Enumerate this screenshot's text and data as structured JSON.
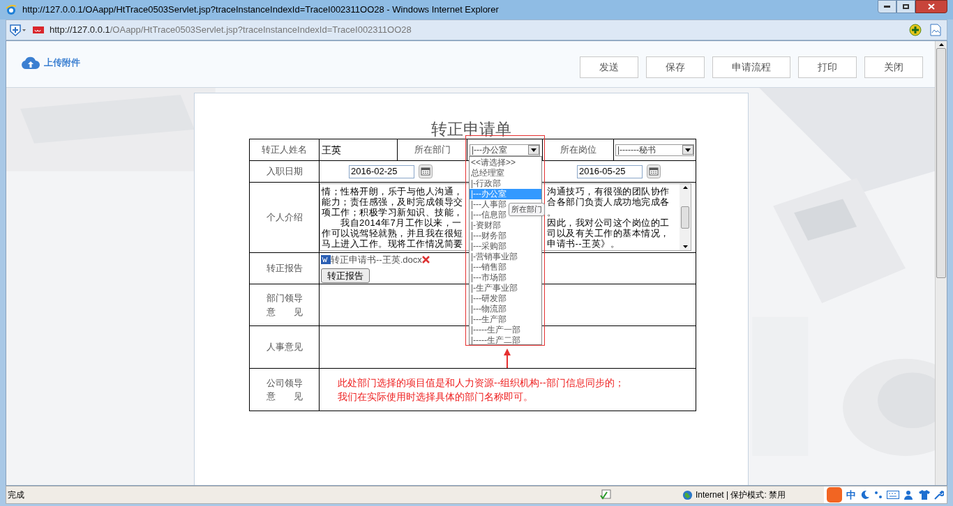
{
  "window": {
    "title": "http://127.0.0.1/OAapp/HtTrace0503Servlet.jsp?traceInstanceIndexId=TraceI002311OO28 - Windows Internet Explorer"
  },
  "address_bar": {
    "host": "http://127.0.0.1",
    "path": "/OAapp/HtTrace0503Servlet.jsp?traceInstanceIndexId=TraceI002311OO28"
  },
  "toolbar": {
    "upload_label": "上传附件",
    "buttons": [
      "发送",
      "保存",
      "申请流程",
      "打印",
      "关闭"
    ]
  },
  "form": {
    "title": "转正申请单",
    "name_label": "转正人姓名",
    "name_value": "王英",
    "dept_label": "所在部门",
    "dept_select": "|---办公室",
    "post_label": "所在岗位",
    "post_select": "|-------秘书",
    "date_label": "入职日期",
    "start_date": "2016-02-25",
    "end_date": "2016-05-25",
    "intro_label": "个人介绍",
    "intro_lines": [
      {
        "left": "情；性格开朗，乐于与他人沟通，",
        "right": "沟通技巧，有很强的团队协作"
      },
      {
        "left": "能力；责任感强，及时完成领导交",
        "right": "合各部门负责人成功地完成各"
      },
      {
        "left": "项工作；积极学习新知识、技能，",
        "right": "。"
      },
      {
        "left": "　　我自2014年7月工作以来，一",
        "right": "因此，我对公司这个岗位的工"
      },
      {
        "left": "作可以说驾轻就熟，并且我在很短",
        "right": "司以及有关工作的基本情况，"
      },
      {
        "left": "马上进入工作。现将工作情况简要",
        "right": "申请书--王英》。"
      }
    ],
    "report_label": "转正报告",
    "attachment": "转正申请书--王英.docx",
    "report_button": "转正报告",
    "dept_opinion_label": [
      "部门领导",
      "意　　见"
    ],
    "hr_opinion_label": "人事意见",
    "company_opinion_label": [
      "公司领导",
      "意　　见"
    ],
    "note_lines": [
      "此处部门选择的项目值是和人力资源--组织机构--部门信息同步的；",
      "我们在实际使用时选择具体的部门名称即可。"
    ]
  },
  "dept_dropdown": {
    "options": [
      {
        "label": "<<请选择>>",
        "selected": false
      },
      {
        "label": "总经理室",
        "selected": false
      },
      {
        "label": "|-行政部",
        "selected": false
      },
      {
        "label": "|---办公室",
        "selected": true
      },
      {
        "label": "|---人事部",
        "selected": false
      },
      {
        "label": "|---信息部",
        "selected": false
      },
      {
        "label": "|-资财部",
        "selected": false
      },
      {
        "label": "|---财务部",
        "selected": false
      },
      {
        "label": "|---采购部",
        "selected": false
      },
      {
        "label": "|-营销事业部",
        "selected": false
      },
      {
        "label": "|---销售部",
        "selected": false
      },
      {
        "label": "|---市场部",
        "selected": false
      },
      {
        "label": "|-生产事业部",
        "selected": false
      },
      {
        "label": "|---研发部",
        "selected": false
      },
      {
        "label": "|---物流部",
        "selected": false
      },
      {
        "label": "|---生产部",
        "selected": false
      },
      {
        "label": "|-----生产一部",
        "selected": false
      },
      {
        "label": "|-----生产二部",
        "selected": false
      }
    ],
    "tooltip": "所在部门"
  },
  "status_bar": {
    "text": "完成",
    "zone": "Internet | 保护模式: 禁用",
    "ime": "中"
  }
}
